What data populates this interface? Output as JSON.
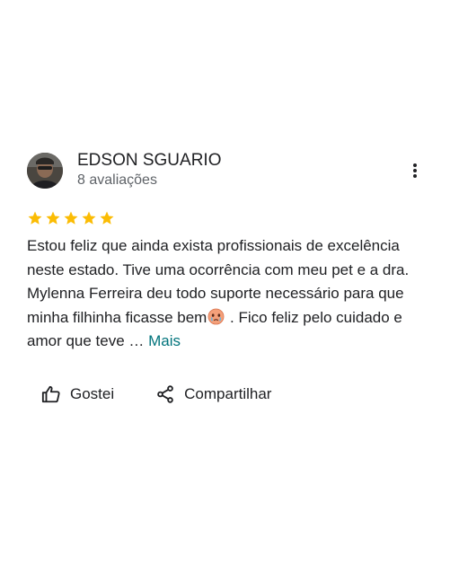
{
  "review": {
    "author": {
      "name": "EDSON SGUARIO",
      "review_count": "8 avaliações",
      "avatar_icon": "profile-photo"
    },
    "rating": 5,
    "max_rating": 5,
    "star_color": "#fbbc04",
    "text": {
      "part1": "Estou feliz que ainda exista profissionais de excelência neste estado. Tive uma ocorrência com meu pet e a dra. Mylenna Ferreira deu todo suporte necessário para que minha filhinha ficasse bem",
      "emoji_icon": "crying-face-emoji",
      "part2": " . Fico feliz pelo cuidado e amor que teve … ",
      "more_label": "Mais"
    },
    "menu_icon": "more-vert-icon",
    "actions": {
      "like_label": "Gostei",
      "like_icon": "thumb-up-icon",
      "share_label": "Compartilhar",
      "share_icon": "share-icon"
    },
    "colors": {
      "link": "#00737b",
      "secondary_text": "#5f6368",
      "primary_text": "#202124"
    }
  }
}
